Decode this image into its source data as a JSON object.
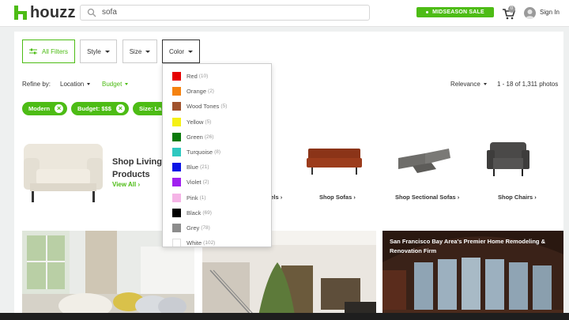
{
  "header": {
    "logo_text": "houzz",
    "search_value": "sofa",
    "sale_label": "MIDSEASON SALE",
    "cart_count": "0",
    "signin_label": "Sign In"
  },
  "filters": {
    "all_filters": "All Filters",
    "style": "Style",
    "size": "Size",
    "color": "Color"
  },
  "refine": {
    "label": "Refine by:",
    "location": "Location",
    "budget": "Budget",
    "sort": "Relevance",
    "results": "1 - 18 of 1,311 photos"
  },
  "chips": [
    {
      "label": "Modern"
    },
    {
      "label": "Budget: $$$"
    },
    {
      "label": "Size: La"
    }
  ],
  "shop": {
    "title_line1": "Shop Living",
    "title_line2": "Products",
    "view_all": "View All",
    "categories": [
      {
        "label": "...els"
      },
      {
        "label": "Shop Sofas"
      },
      {
        "label": "Shop Sectional Sofas"
      },
      {
        "label": "Shop Chairs"
      }
    ]
  },
  "photo_caption": "San Francisco Bay Area's Premier Home Remodeling & Renovation Firm",
  "color_options": [
    {
      "name": "Red",
      "count": "(10)",
      "color": "#e60000"
    },
    {
      "name": "Orange",
      "count": "(2)",
      "color": "#f5820f"
    },
    {
      "name": "Wood Tones",
      "count": "(5)",
      "color": "#a0522d"
    },
    {
      "name": "Yellow",
      "count": "(5)",
      "color": "#f5f014"
    },
    {
      "name": "Green",
      "count": "(26)",
      "color": "#0a7a0a"
    },
    {
      "name": "Turquoise",
      "count": "(8)",
      "color": "#2ec8c0"
    },
    {
      "name": "Blue",
      "count": "(21)",
      "color": "#0a14e6"
    },
    {
      "name": "Violet",
      "count": "(2)",
      "color": "#a020f0"
    },
    {
      "name": "Pink",
      "count": "(1)",
      "color": "#f5b4e6"
    },
    {
      "name": "Black",
      "count": "(69)",
      "color": "#000000"
    },
    {
      "name": "Grey",
      "count": "(78)",
      "color": "#8c8c8c"
    },
    {
      "name": "White",
      "count": "(102)",
      "color": "#ffffff"
    }
  ],
  "colors": {
    "brand_green": "#4dbc15"
  }
}
